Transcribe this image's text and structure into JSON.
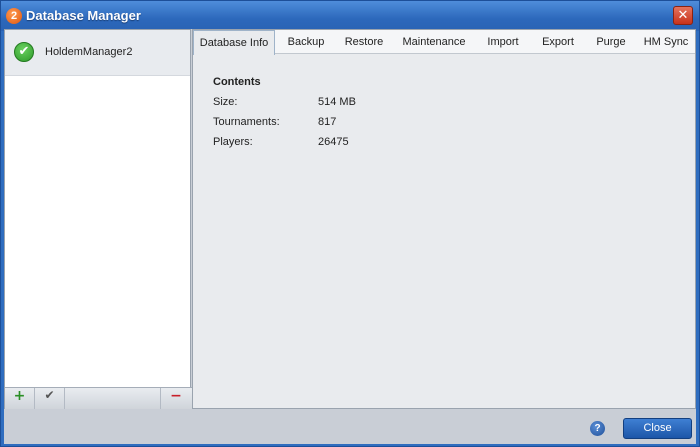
{
  "window": {
    "title": "Database Manager",
    "app_icon_text": "2",
    "close_glyph": "✕"
  },
  "databases": [
    {
      "name": "HoldemManager2",
      "status": "connected"
    }
  ],
  "left_toolbar": {
    "add_glyph": "+",
    "check_glyph": "✔",
    "remove_glyph": "−"
  },
  "tabs": [
    {
      "label": "Database Info",
      "active": true
    },
    {
      "label": "Backup",
      "active": false
    },
    {
      "label": "Restore",
      "active": false
    },
    {
      "label": "Maintenance",
      "active": false
    },
    {
      "label": "Import",
      "active": false
    },
    {
      "label": "Export",
      "active": false
    },
    {
      "label": "Purge",
      "active": false
    },
    {
      "label": "HM Sync",
      "active": false
    }
  ],
  "info": {
    "heading": "Contents",
    "rows": [
      {
        "label": "Size:",
        "value": "514 MB"
      },
      {
        "label": "Tournaments:",
        "value": "817"
      },
      {
        "label": "Players:",
        "value": "26475"
      }
    ]
  },
  "footer": {
    "help_glyph": "?",
    "close_label": "Close"
  },
  "colors": {
    "titlebar": "#2c68bb",
    "accent_button": "#1c56a8",
    "add_green": "#2a8f25",
    "remove_red": "#c8202a"
  }
}
